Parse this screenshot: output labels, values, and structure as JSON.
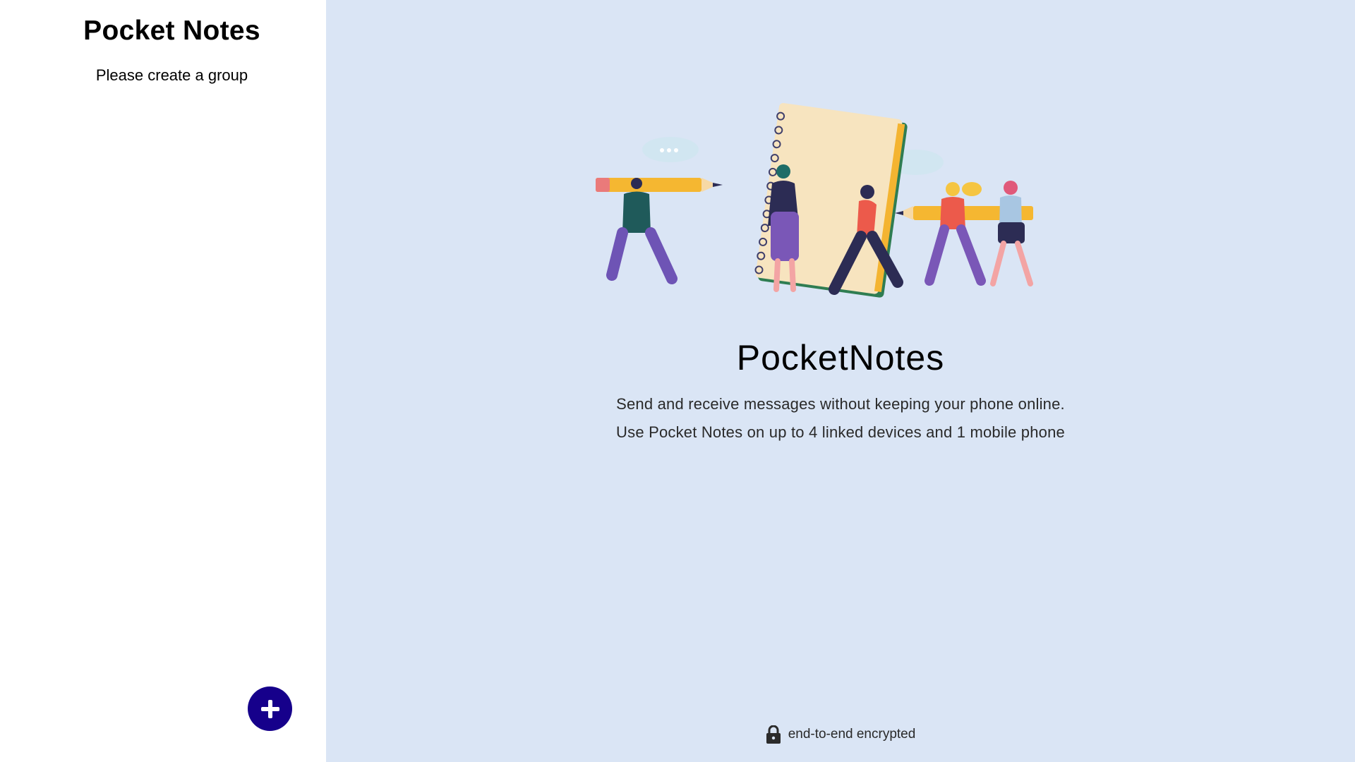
{
  "sidebar": {
    "title": "Pocket Notes",
    "empty_message": "Please create a group",
    "add_button_icon": "plus-icon"
  },
  "main": {
    "app_name": "PocketNotes",
    "tagline_line1": "Send and receive messages without keeping your phone online.",
    "tagline_line2": "Use Pocket Notes on up to 4 linked devices and 1 mobile phone",
    "footer_icon": "lock-icon",
    "footer_text": "end-to-end encrypted"
  },
  "colors": {
    "sidebar_bg": "#ffffff",
    "main_bg": "#dae5f5",
    "accent": "#16008b"
  }
}
